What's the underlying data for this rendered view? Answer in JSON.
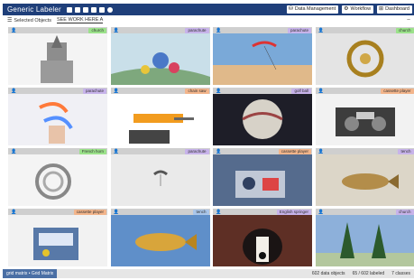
{
  "app": {
    "title": "Generic Labeler",
    "toolbar_icons": [
      "camera-icon",
      "folder-icon",
      "save-icon",
      "trash-icon",
      "edit-icon",
      "settings-icon"
    ]
  },
  "top_actions": [
    {
      "label": "Data Management",
      "icon": "database-icon"
    },
    {
      "label": "Workflow",
      "icon": "workflow-icon"
    },
    {
      "label": "Dashboard",
      "icon": "dashboard-icon"
    }
  ],
  "tabs": [
    {
      "label": "Selected Objects"
    },
    {
      "label": "SEE WORK HERE A"
    }
  ],
  "cards": [
    {
      "tag": "church",
      "tag_color": "#9be28a",
      "scene": "tower"
    },
    {
      "tag": "parachute",
      "tag_color": "#c7b3ea",
      "scene": "balloons"
    },
    {
      "tag": "parachute",
      "tag_color": "#c7b3ea",
      "scene": "kite"
    },
    {
      "tag": "church",
      "tag_color": "#9be28a",
      "scene": "tuba"
    },
    {
      "tag": "parachute",
      "tag_color": "#c7b3ea",
      "scene": "hand"
    },
    {
      "tag": "chain saw",
      "tag_color": "#f3b58b",
      "scene": "chainsaw"
    },
    {
      "tag": "golf ball",
      "tag_color": "#c7b3ea",
      "scene": "golfball"
    },
    {
      "tag": "cassette player",
      "tag_color": "#f3b58b",
      "scene": "cassette"
    },
    {
      "tag": "French horn",
      "tag_color": "#9be28a",
      "scene": "horn"
    },
    {
      "tag": "parachute",
      "tag_color": "#c7b3ea",
      "scene": "sky"
    },
    {
      "tag": "cassette player",
      "tag_color": "#f3b58b",
      "scene": "gadget"
    },
    {
      "tag": "tench",
      "tag_color": "#c7b3ea",
      "scene": "fish"
    },
    {
      "tag": "cassette player",
      "tag_color": "#f3b58b",
      "scene": "radio"
    },
    {
      "tag": "tench",
      "tag_color": "#a9c6ea",
      "scene": "fish2"
    },
    {
      "tag": "English springer",
      "tag_color": "#c7b3ea",
      "scene": "dog"
    },
    {
      "tag": "church",
      "tag_color": "#c7b3ea",
      "scene": "trees"
    }
  ],
  "footer": {
    "left": "grid matrix • Grid Matrix",
    "stats": [
      "602 data objects",
      "65 / 602 labeled",
      "7 classes"
    ]
  }
}
